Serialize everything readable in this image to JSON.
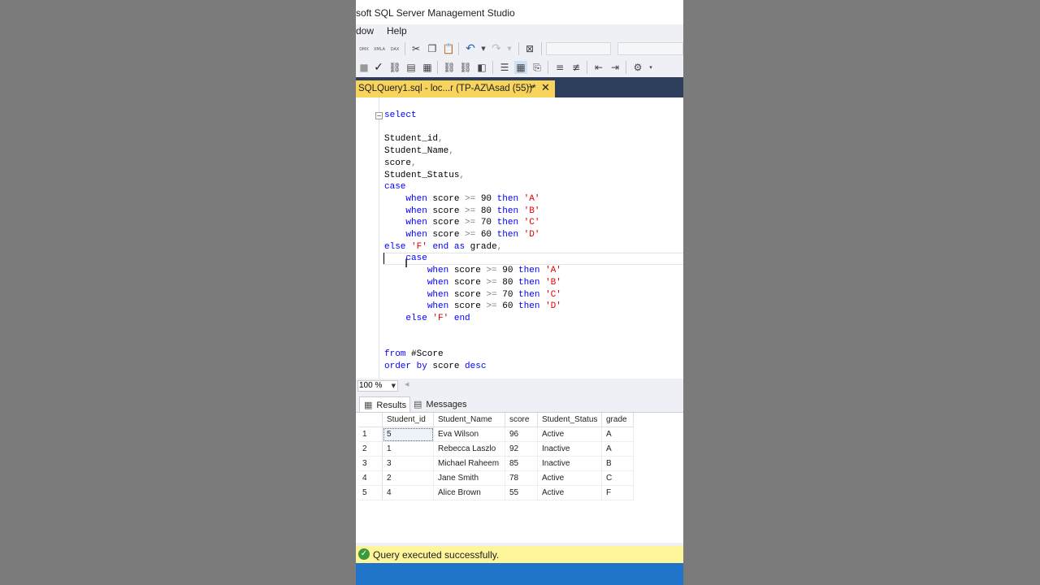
{
  "window": {
    "title": "soft SQL Server Management Studio"
  },
  "menu": {
    "items": [
      "dow",
      "Help"
    ]
  },
  "toolbar1": {
    "icons": [
      "dmx-query-icon",
      "xmla-query-icon",
      "dax-query-icon",
      "cut-icon",
      "copy-icon",
      "paste-icon",
      "undo-icon",
      "undo-dropdown-icon",
      "redo-icon",
      "redo-dropdown-icon",
      "object-explorer-icon"
    ],
    "mini_labels": [
      "DMX",
      "XMLA",
      "DAX"
    ]
  },
  "toolbar2": {
    "icons": [
      "execute-icon",
      "parse-check-icon",
      "display-plan-icon",
      "query-options-icon",
      "intellisense-icon",
      "results-text-icon",
      "results-grid-icon",
      "results-file-icon",
      "comment-icon",
      "uncomment-icon",
      "outdent-icon",
      "indent-icon",
      "specify-values-icon"
    ]
  },
  "document_tab": {
    "label": "SQLQuery1.sql - loc...r (TP-AZ\\Asad (55))*",
    "pin": "⊸",
    "close": "✕"
  },
  "editor": {
    "code_lines": [
      [
        {
          "t": "select",
          "c": "k"
        }
      ],
      [],
      [
        {
          "t": "Student_id"
        },
        {
          "t": ",",
          "c": "o"
        }
      ],
      [
        {
          "t": "Student_Name"
        },
        {
          "t": ",",
          "c": "o"
        }
      ],
      [
        {
          "t": "score"
        },
        {
          "t": ",",
          "c": "o"
        }
      ],
      [
        {
          "t": "Student_Status"
        },
        {
          "t": ",",
          "c": "o"
        }
      ],
      [
        {
          "t": "case",
          "c": "k"
        }
      ],
      [
        {
          "t": "    "
        },
        {
          "t": "when",
          "c": "k"
        },
        {
          "t": " score "
        },
        {
          "t": ">=",
          "c": "o"
        },
        {
          "t": " 90 "
        },
        {
          "t": "then",
          "c": "k"
        },
        {
          "t": " "
        },
        {
          "t": "'A'",
          "c": "s"
        }
      ],
      [
        {
          "t": "    "
        },
        {
          "t": "when",
          "c": "k"
        },
        {
          "t": " score "
        },
        {
          "t": ">=",
          "c": "o"
        },
        {
          "t": " 80 "
        },
        {
          "t": "then",
          "c": "k"
        },
        {
          "t": " "
        },
        {
          "t": "'B'",
          "c": "s"
        }
      ],
      [
        {
          "t": "    "
        },
        {
          "t": "when",
          "c": "k"
        },
        {
          "t": " score "
        },
        {
          "t": ">=",
          "c": "o"
        },
        {
          "t": " 70 "
        },
        {
          "t": "then",
          "c": "k"
        },
        {
          "t": " "
        },
        {
          "t": "'C'",
          "c": "s"
        }
      ],
      [
        {
          "t": "    "
        },
        {
          "t": "when",
          "c": "k"
        },
        {
          "t": " score "
        },
        {
          "t": ">=",
          "c": "o"
        },
        {
          "t": " 60 "
        },
        {
          "t": "then",
          "c": "k"
        },
        {
          "t": " "
        },
        {
          "t": "'D'",
          "c": "s"
        }
      ],
      [
        {
          "t": "else",
          "c": "k"
        },
        {
          "t": " "
        },
        {
          "t": "'F'",
          "c": "s"
        },
        {
          "t": " "
        },
        {
          "t": "end",
          "c": "k"
        },
        {
          "t": " "
        },
        {
          "t": "as",
          "c": "k"
        },
        {
          "t": " grade"
        },
        {
          "t": ",",
          "c": "o"
        }
      ],
      [
        {
          "t": "    "
        },
        {
          "t": "case",
          "c": "k"
        }
      ],
      [
        {
          "t": "        "
        },
        {
          "t": "when",
          "c": "k"
        },
        {
          "t": " score "
        },
        {
          "t": ">=",
          "c": "o"
        },
        {
          "t": " 90 "
        },
        {
          "t": "then",
          "c": "k"
        },
        {
          "t": " "
        },
        {
          "t": "'A'",
          "c": "s"
        }
      ],
      [
        {
          "t": "        "
        },
        {
          "t": "when",
          "c": "k"
        },
        {
          "t": " score "
        },
        {
          "t": ">=",
          "c": "o"
        },
        {
          "t": " 80 "
        },
        {
          "t": "then",
          "c": "k"
        },
        {
          "t": " "
        },
        {
          "t": "'B'",
          "c": "s"
        }
      ],
      [
        {
          "t": "        "
        },
        {
          "t": "when",
          "c": "k"
        },
        {
          "t": " score "
        },
        {
          "t": ">=",
          "c": "o"
        },
        {
          "t": " 70 "
        },
        {
          "t": "then",
          "c": "k"
        },
        {
          "t": " "
        },
        {
          "t": "'C'",
          "c": "s"
        }
      ],
      [
        {
          "t": "        "
        },
        {
          "t": "when",
          "c": "k"
        },
        {
          "t": " score "
        },
        {
          "t": ">=",
          "c": "o"
        },
        {
          "t": " 60 "
        },
        {
          "t": "then",
          "c": "k"
        },
        {
          "t": " "
        },
        {
          "t": "'D'",
          "c": "s"
        }
      ],
      [
        {
          "t": "    "
        },
        {
          "t": "else",
          "c": "k"
        },
        {
          "t": " "
        },
        {
          "t": "'F'",
          "c": "s"
        },
        {
          "t": " "
        },
        {
          "t": "end",
          "c": "k"
        }
      ],
      [],
      [],
      [
        {
          "t": "from",
          "c": "k"
        },
        {
          "t": " #Score"
        }
      ],
      [
        {
          "t": "order",
          "c": "k"
        },
        {
          "t": " "
        },
        {
          "t": "by",
          "c": "k"
        },
        {
          "t": " score "
        },
        {
          "t": "desc",
          "c": "k"
        }
      ]
    ]
  },
  "zoom": {
    "value": "100 %"
  },
  "results_tabs": {
    "results": "Results",
    "messages": "Messages"
  },
  "results_grid": {
    "columns": [
      "Student_id",
      "Student_Name",
      "score",
      "Student_Status",
      "grade"
    ],
    "rows": [
      [
        "1",
        "5",
        "Eva Wilson",
        "96",
        "Active",
        "A"
      ],
      [
        "2",
        "1",
        "Rebecca Laszlo",
        "92",
        "Inactive",
        "A"
      ],
      [
        "3",
        "3",
        "Michael Raheem",
        "85",
        "Inactive",
        "B"
      ],
      [
        "4",
        "2",
        "Jane Smith",
        "78",
        "Active",
        "C"
      ],
      [
        "5",
        "4",
        "Alice Brown",
        "55",
        "Active",
        "F"
      ]
    ]
  },
  "status": {
    "text": "Query executed successfully."
  },
  "colors": {
    "keyword": "#0000ff",
    "string": "#e00000",
    "operator": "#808080",
    "tab_active": "#f7d45b",
    "status_bar": "#fff59a",
    "bottom_bar": "#1f73c8"
  }
}
